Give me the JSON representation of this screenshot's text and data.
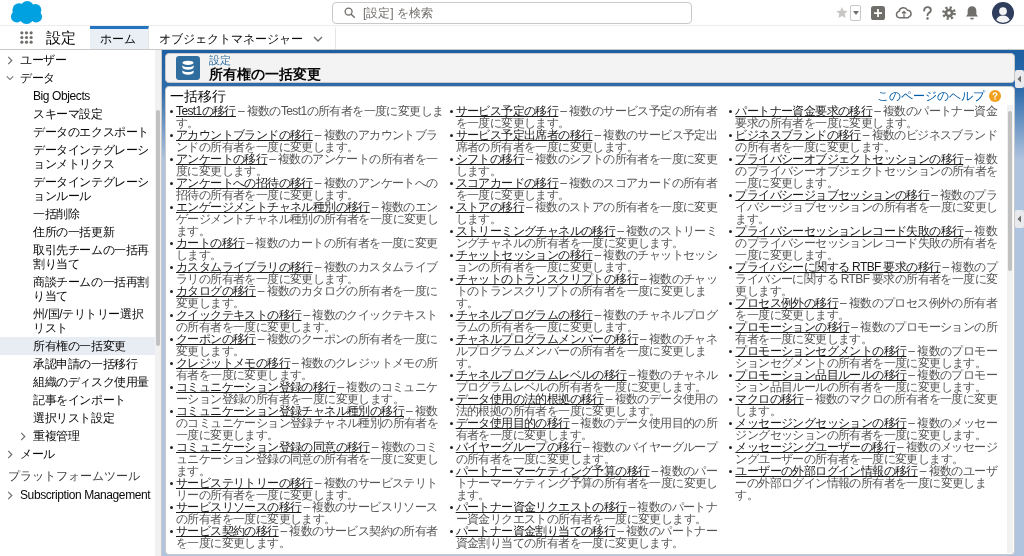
{
  "top_bar": {
    "search": {
      "placeholder": "[設定] を検索"
    }
  },
  "nav": {
    "app_name": "設定",
    "tabs": [
      {
        "label": "ホーム",
        "selected": true,
        "kind": "tab"
      },
      {
        "label": "オブジェクトマネージャー",
        "selected": false,
        "kind": "menu"
      }
    ]
  },
  "sidebar": {
    "sections": [
      {
        "items": [
          {
            "label": "ユーザー",
            "kind": "folder",
            "expanded": false
          },
          {
            "label": "データ",
            "kind": "folder",
            "expanded": true,
            "children": [
              {
                "label": "Big Objects",
                "kind": "page",
                "selected": false
              },
              {
                "label": "スキーマ設定",
                "kind": "page",
                "selected": false
              },
              {
                "label": "データのエクスポート",
                "kind": "page",
                "selected": false
              },
              {
                "label": "データインテグレーションメトリクス",
                "kind": "page",
                "selected": false
              },
              {
                "label": "データインテグレーションルール",
                "kind": "page",
                "selected": false
              },
              {
                "label": "一括削除",
                "kind": "page",
                "selected": false
              },
              {
                "label": "住所の一括更新",
                "kind": "page",
                "selected": false
              },
              {
                "label": "取引先チームの一括再割り当て",
                "kind": "page",
                "selected": false
              },
              {
                "label": "商談チームの一括再割り当て",
                "kind": "page",
                "selected": false
              },
              {
                "label": "州/国/テリトリー選択リスト",
                "kind": "page",
                "selected": false
              },
              {
                "label": "所有権の一括変更",
                "kind": "page",
                "selected": true
              },
              {
                "label": "承認申請の一括移行",
                "kind": "page",
                "selected": false
              },
              {
                "label": "組織のディスク使用量",
                "kind": "page",
                "selected": false
              },
              {
                "label": "記事をインポート",
                "kind": "page",
                "selected": false
              },
              {
                "label": "選択リスト設定",
                "kind": "page",
                "selected": false
              },
              {
                "label": "重複管理",
                "kind": "folder",
                "expanded": false,
                "selected": false
              }
            ]
          },
          {
            "label": "メール",
            "kind": "folder",
            "expanded": false
          }
        ]
      },
      {
        "title": "プラットフォームツール",
        "items": [
          {
            "label": "Subscription Management",
            "kind": "folder",
            "expanded": false
          }
        ]
      }
    ]
  },
  "page_header": {
    "breadcrumb": "設定",
    "title": "所有権の一括変更"
  },
  "content": {
    "heading": "一括移行",
    "help_link": "このページのヘルプ",
    "items": [
      {
        "link": "Test1の移行",
        "description": "– 複数のTest1の所有者を一度に変更します。"
      },
      {
        "link": "アカウントブランドの移行",
        "description": "– 複数のアカウントブランドの所有者を一度に変更します。"
      },
      {
        "link": "アンケートの移行",
        "description": "– 複数のアンケートの所有者を一度に変更します。"
      },
      {
        "link": "アンケートへの招待の移行",
        "description": "– 複数のアンケートへの招待の所有者を一度に変更します。"
      },
      {
        "link": "エンゲージメントチャネル種別の移行",
        "description": "– 複数のエンゲージメントチャネル種別の所有者を一度に変更します。"
      },
      {
        "link": "カートの移行",
        "description": "– 複数のカートの所有者を一度に変更します。"
      },
      {
        "link": "カスタムライブラリの移行",
        "description": "– 複数のカスタムライブラリの所有者を一度に変更します。"
      },
      {
        "link": "カタログの移行",
        "description": "– 複数のカタログの所有者を一度に変更します。"
      },
      {
        "link": "クイックテキストの移行",
        "description": "– 複数のクイックテキストの所有者を一度に変更します。"
      },
      {
        "link": "クーポンの移行",
        "description": "– 複数のクーポンの所有者を一度に変更します。"
      },
      {
        "link": "クレジットメモの移行",
        "description": "– 複数のクレジットメモの所有者を一度に変更します。"
      },
      {
        "link": "コミュニケーション登録の移行",
        "description": "– 複数のコミュニケーション登録の所有者を一度に変更します。"
      },
      {
        "link": "コミュニケーション登録チャネル種別の移行",
        "description": "– 複数のコミュニケーション登録チャネル種別の所有者を一度に変更します。"
      },
      {
        "link": "コミュニケーション登録の同意の移行",
        "description": "– 複数のコミュニケーション登録の同意の所有者を一度に変更します。"
      },
      {
        "link": "サービステリトリーの移行",
        "description": "– 複数のサービステリトリーの所有者を一度に変更します。"
      },
      {
        "link": "サービスリソースの移行",
        "description": "– 複数のサービスリソースの所有者を一度に変更します。"
      },
      {
        "link": "サービス契約の移行",
        "description": "– 複数のサービス契約の所有者を一度に変更します。"
      },
      {
        "link": "サービス予定の移行",
        "description": "– 複数のサービス予定の所有者を一度に変更します。"
      },
      {
        "link": "サービス予定出席者の移行",
        "description": "– 複数のサービス予定出席者の所有者を一度に変更します。"
      },
      {
        "link": "シフトの移行",
        "description": "– 複数のシフトの所有者を一度に変更します。"
      },
      {
        "link": "スコアカードの移行",
        "description": "– 複数のスコアカードの所有者を一度に変更します。"
      },
      {
        "link": "ストアの移行",
        "description": "– 複数のストアの所有者を一度に変更します。"
      },
      {
        "link": "ストリーミングチャネルの移行",
        "description": "– 複数のストリーミングチャネルの所有者を一度に変更します。"
      },
      {
        "link": "チャットセッションの移行",
        "description": "– 複数のチャットセッションの所有者を一度に変更します。"
      },
      {
        "link": "チャットのトランスクリプトの移行",
        "description": "– 複数のチャットのトランスクリプトの所有者を一度に変更します。"
      },
      {
        "link": "チャネルプログラムの移行",
        "description": "– 複数のチャネルプログラムの所有者を一度に変更します。"
      },
      {
        "link": "チャネルプログラムメンバーの移行",
        "description": "– 複数のチャネルプログラムメンバーの所有者を一度に変更します。"
      },
      {
        "link": "チャネルプログラムレベルの移行",
        "description": "– 複数のチャネルプログラムレベルの所有者を一度に変更します。"
      },
      {
        "link": "データ使用の法的根拠の移行",
        "description": "– 複数のデータ使用の法的根拠の所有者を一度に変更します。"
      },
      {
        "link": "データ使用目的の移行",
        "description": "– 複数のデータ使用目的の所有者を一度に変更します。"
      },
      {
        "link": "バイヤーグループの移行",
        "description": "– 複数のバイヤーグループの所有者を一度に変更します。"
      },
      {
        "link": "パートナーマーケティング予算の移行",
        "description": "– 複数のパートナーマーケティング予算の所有者を一度に変更します。"
      },
      {
        "link": "パートナー資金リクエストの移行",
        "description": "– 複数のパートナー資金リクエストの所有者を一度に変更します。"
      },
      {
        "link": "パートナー資金割り当ての移行",
        "description": "– 複数のパートナー資金割り当ての所有者を一度に変更します。"
      },
      {
        "link": "パートナー資金要求の移行",
        "description": "– 複数のパートナー資金要求の所有者を一度に変更します。"
      },
      {
        "link": "ビジネスブランドの移行",
        "description": "– 複数のビジネスブランドの所有者を一度に変更します。"
      },
      {
        "link": "プライバシーオブジェクトセッションの移行",
        "description": "– 複数のプライバシーオブジェクトセッションの所有者を一度に変更します。"
      },
      {
        "link": "プライバシージョブセッションの移行",
        "description": "– 複数のプライバシージョブセッションの所有者を一度に変更します。"
      },
      {
        "link": "プライバシーセッションレコード失敗の移行",
        "description": "– 複数のプライバシーセッションレコード失敗の所有者を一度に変更します。"
      },
      {
        "link": "プライバシーに関する RTBF 要求の移行",
        "description": "– 複数のプライバシーに関する RTBF 要求の所有者を一度に変更します。"
      },
      {
        "link": "プロセス例外の移行",
        "description": "– 複数のプロセス例外の所有者を一度に変更します。"
      },
      {
        "link": "プロモーションの移行",
        "description": "– 複数のプロモーションの所有者を一度に変更します。"
      },
      {
        "link": "プロモーションセグメントの移行",
        "description": "– 複数のプロモーションセグメントの所有者を一度に変更します。"
      },
      {
        "link": "プロモーション品目ルールの移行",
        "description": "– 複数のプロモーション品目ルールの所有者を一度に変更します。"
      },
      {
        "link": "マクロの移行",
        "description": "– 複数のマクロの所有者を一度に変更します。"
      },
      {
        "link": "メッセージングセッションの移行",
        "description": "– 複数のメッセージングセッションの所有者を一度に変更します。"
      },
      {
        "link": "メッセージングユーザーの移行",
        "description": "– 複数のメッセージングユーザーの所有者を一度に変更します。"
      },
      {
        "link": "ユーザーの外部ログイン情報の移行",
        "description": "– 複数のユーザーの外部ログイン情報の所有者を一度に変更します。"
      }
    ]
  }
}
